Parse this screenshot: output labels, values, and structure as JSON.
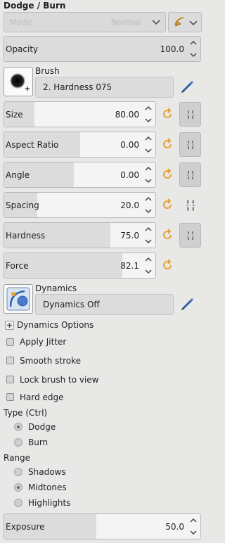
{
  "title": "Dodge / Burn",
  "mode": {
    "label": "Mode",
    "value": "Normal"
  },
  "opacity": {
    "label": "Opacity",
    "value": "100.0",
    "fraction": 1.0
  },
  "brush": {
    "heading": "Brush",
    "name": "2. Hardness 075"
  },
  "sliders": {
    "size": {
      "label": "Size",
      "value": "80.00"
    },
    "aspect": {
      "label": "Aspect Ratio",
      "value": "0.00"
    },
    "angle": {
      "label": "Angle",
      "value": "0.00"
    },
    "spacing": {
      "label": "Spacing",
      "value": "20.0"
    },
    "hardness": {
      "label": "Hardness",
      "value": "75.0"
    },
    "force": {
      "label": "Force",
      "value": "82.1"
    }
  },
  "dynamics": {
    "heading": "Dynamics",
    "name": "Dynamics Off",
    "options_label": "Dynamics Options"
  },
  "checkboxes": {
    "jitter": "Apply Jitter",
    "smooth": "Smooth stroke",
    "lock": "Lock brush to view",
    "hard": "Hard edge"
  },
  "type": {
    "heading": "Type  (Ctrl)",
    "dodge": "Dodge",
    "burn": "Burn",
    "selected": "Dodge"
  },
  "range": {
    "heading": "Range",
    "shadows": "Shadows",
    "midtones": "Midtones",
    "highlights": "Highlights",
    "selected": "Midtones"
  },
  "exposure": {
    "label": "Exposure",
    "value": "50.0"
  },
  "colors": {
    "accent_orange": "#e8a23a",
    "pencil_blue": "#2f5fa8"
  }
}
